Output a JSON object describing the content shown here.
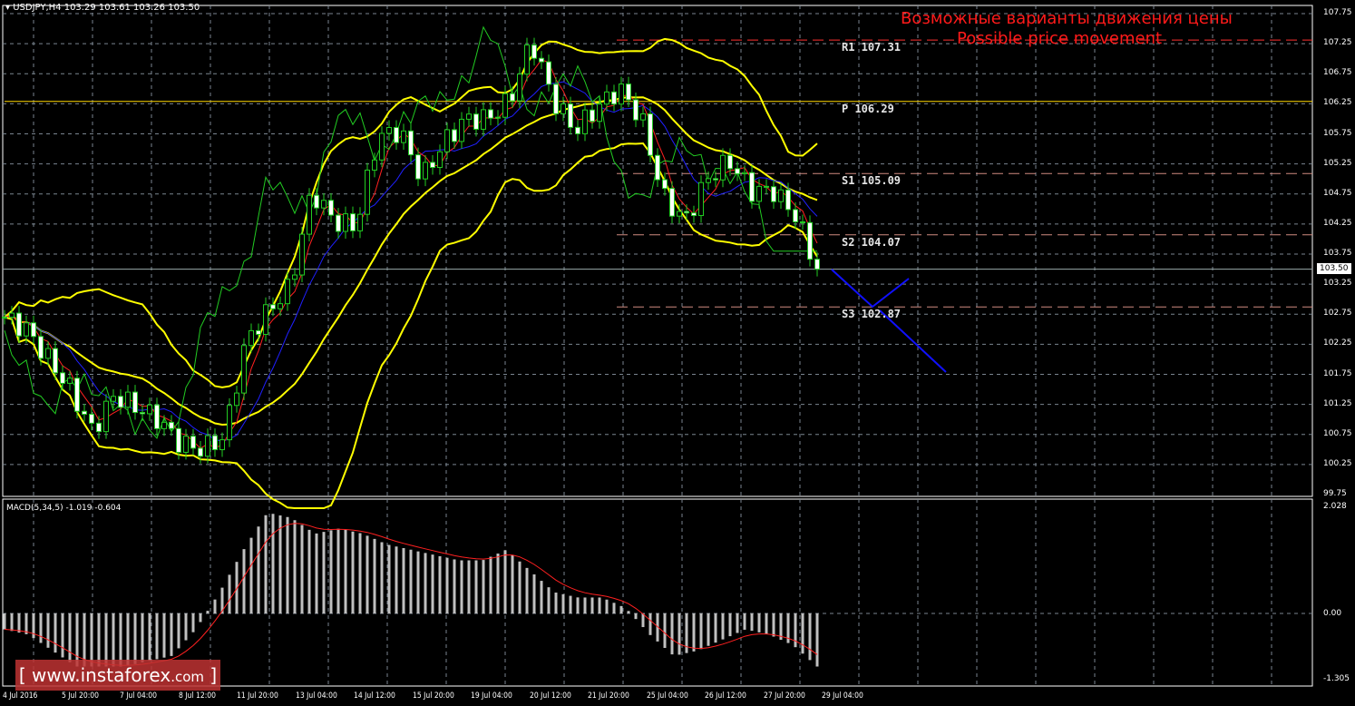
{
  "header": {
    "symbol": "USDJPY,H4",
    "ohlc": "103.29 103.61 103.26 103.50"
  },
  "annotation": {
    "title_ru": "Возможные варианты движения цены",
    "title_en": "Possible price movement"
  },
  "price_axis": [
    "107.75",
    "107.25",
    "106.75",
    "106.25",
    "105.75",
    "105.25",
    "104.75",
    "104.25",
    "103.75",
    "103.25",
    "102.75",
    "102.25",
    "101.75",
    "101.25",
    "100.75",
    "100.25",
    "99.75"
  ],
  "current_price": "103.50",
  "pivots": [
    {
      "label": "R1 107.31",
      "value": 107.31,
      "color": "#ff3030"
    },
    {
      "label": "P 106.29",
      "value": 106.29,
      "color": "#ffd700"
    },
    {
      "label": "S1 105.09",
      "value": 105.09,
      "color": "#d08a80"
    },
    {
      "label": "S2 104.07",
      "value": 104.07,
      "color": "#d08a80"
    },
    {
      "label": "S3 102.87",
      "value": 102.87,
      "color": "#d08a80"
    }
  ],
  "time_axis": [
    "4 Jul 2016",
    "5 Jul 20:00",
    "7 Jul 04:00",
    "8 Jul 12:00",
    "11 Jul 20:00",
    "13 Jul 04:00",
    "14 Jul 12:00",
    "15 Jul 20:00",
    "19 Jul 04:00",
    "20 Jul 12:00",
    "21 Jul 20:00",
    "25 Jul 04:00",
    "26 Jul 12:00",
    "27 Jul 20:00",
    "29 Jul 04:00"
  ],
  "macd": {
    "label": "MACD(5,34,5) -1.019 -0.604",
    "axis": [
      "2.028",
      "0.00",
      "-1.305"
    ]
  },
  "logo": {
    "text": "www.instaforex",
    "suffix": ".com",
    "bracket_open": "[",
    "bracket_close": "]"
  },
  "chart_data": {
    "type": "line",
    "title": "USDJPY H4",
    "ylim": [
      99.75,
      107.75
    ],
    "close_keypoints": [
      102.7,
      102.5,
      102.0,
      101.5,
      100.8,
      101.4,
      101.2,
      101.0,
      100.6,
      100.5,
      100.7,
      102.3,
      102.8,
      103.2,
      104.8,
      104.3,
      104.2,
      105.7,
      105.8,
      105.0,
      105.6,
      106.0,
      106.0,
      106.3,
      107.3,
      106.3,
      105.8,
      106.2,
      106.5,
      106.0,
      104.7,
      104.3,
      105.0,
      105.3,
      104.8,
      104.8,
      104.4,
      103.5
    ],
    "macd_keypoints": [
      -0.3,
      -0.4,
      -0.7,
      -1.0,
      -1.0,
      -1.0,
      -0.9,
      -0.8,
      -0.3,
      0.4,
      1.2,
      1.9,
      1.8,
      1.5,
      1.6,
      1.5,
      1.3,
      1.2,
      1.1,
      1.0,
      1.0,
      1.2,
      0.8,
      0.4,
      0.3,
      0.3,
      0.1,
      -0.4,
      -0.8,
      -0.7,
      -0.5,
      -0.3,
      -0.4,
      -0.6,
      -1.0
    ],
    "forecast": "down toward S3 102.87 then possible rebound"
  }
}
